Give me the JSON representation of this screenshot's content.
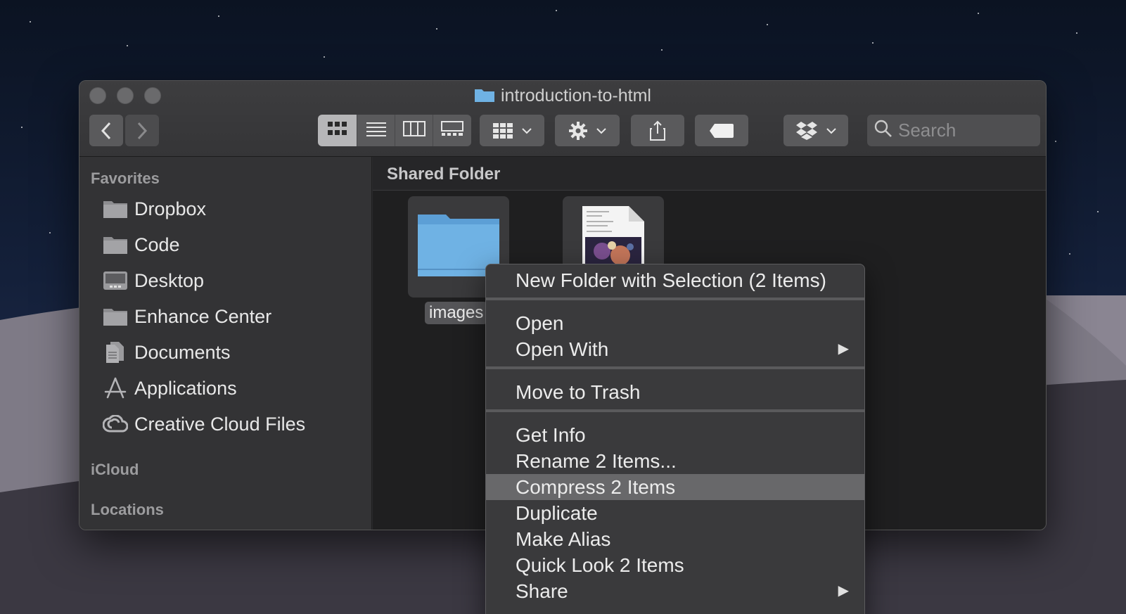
{
  "window": {
    "title": "introduction-to-html"
  },
  "toolbar": {
    "back_icon": "chevron-left-icon",
    "forward_icon": "chevron-right-icon",
    "view_modes": [
      "icon-view-icon",
      "list-view-icon",
      "column-view-icon",
      "gallery-view-icon"
    ],
    "active_view": "icon-view-icon",
    "search_placeholder": "Search"
  },
  "sidebar": {
    "favorites_label": "Favorites",
    "items": [
      {
        "label": "Dropbox",
        "icon": "folder-icon"
      },
      {
        "label": "Code",
        "icon": "folder-icon"
      },
      {
        "label": "Desktop",
        "icon": "desktop-icon"
      },
      {
        "label": "Enhance Center",
        "icon": "folder-icon"
      },
      {
        "label": "Documents",
        "icon": "document-icon"
      },
      {
        "label": "Applications",
        "icon": "applications-icon"
      },
      {
        "label": "Creative Cloud Files",
        "icon": "creative-cloud-icon"
      }
    ],
    "icloud_label": "iCloud",
    "locations_label": "Locations"
  },
  "content": {
    "path_header": "Shared Folder",
    "files": [
      {
        "label": "images",
        "icon": "folder-icon"
      }
    ]
  },
  "context_menu": {
    "items": [
      {
        "label": "New Folder with Selection (2 Items)"
      },
      {
        "label": "Open"
      },
      {
        "label": "Open With",
        "submenu": true
      },
      {
        "label": "Move to Trash"
      },
      {
        "label": "Get Info"
      },
      {
        "label": "Rename 2 Items..."
      },
      {
        "label": "Compress 2 Items",
        "highlighted": true
      },
      {
        "label": "Duplicate"
      },
      {
        "label": "Make Alias"
      },
      {
        "label": "Quick Look 2 Items"
      },
      {
        "label": "Share",
        "submenu": true
      }
    ],
    "submenu_arrow": "▶"
  },
  "colors": {
    "folder_blue": "#6fb2e4",
    "highlight": "#68686a"
  }
}
